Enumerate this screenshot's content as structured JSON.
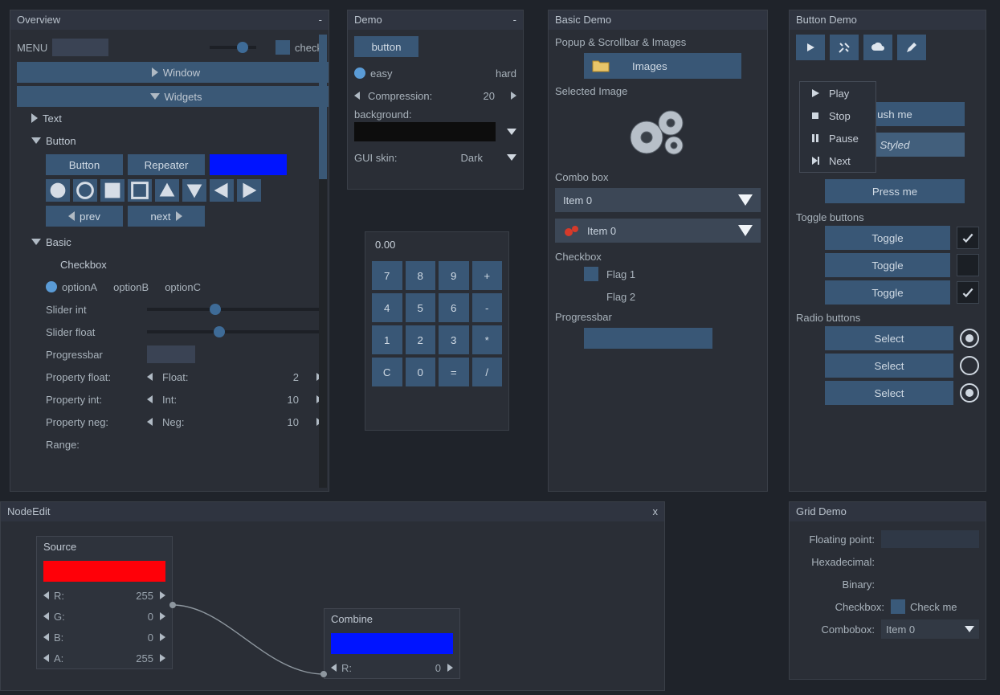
{
  "overview": {
    "title": "Overview",
    "menu_label": "MENU",
    "check_label": "check",
    "tree": {
      "window": "Window",
      "widgets": "Widgets",
      "text": "Text",
      "button": "Button",
      "basic": "Basic",
      "checkbox_label": "Checkbox"
    },
    "buttons": {
      "button": "Button",
      "repeater": "Repeater",
      "prev": "prev",
      "next": "next"
    },
    "options": {
      "a": "optionA",
      "b": "optionB",
      "c": "optionC"
    },
    "sliders": {
      "int_label": "Slider int",
      "float_label": "Slider float"
    },
    "progress_label": "Progressbar",
    "props": {
      "float": {
        "label": "Property float:",
        "name": "Float:",
        "value": "2"
      },
      "int": {
        "label": "Property int:",
        "name": "Int:",
        "value": "10"
      },
      "neg": {
        "label": "Property neg:",
        "name": "Neg:",
        "value": "10"
      },
      "range": "Range:"
    },
    "colors": {
      "swatch": "#0014ff"
    }
  },
  "demo": {
    "title": "Demo",
    "button": "button",
    "easy": "easy",
    "hard": "hard",
    "compression": {
      "label": "Compression:",
      "value": "20"
    },
    "background_label": "background:",
    "gui_skin": {
      "label": "GUI skin:",
      "value": "Dark"
    }
  },
  "calc": {
    "display": "0.00",
    "keys": [
      [
        "7",
        "8",
        "9",
        "+"
      ],
      [
        "4",
        "5",
        "6",
        "-"
      ],
      [
        "1",
        "2",
        "3",
        "*"
      ],
      [
        "C",
        "0",
        "=",
        "/"
      ]
    ]
  },
  "basic_demo": {
    "title": "Basic Demo",
    "popup_label": "Popup & Scrollbar & Images",
    "images_button": "Images",
    "selected_label": "Selected Image",
    "combo_label": "Combo box",
    "combo1": "Item 0",
    "combo2": "Item 0",
    "checkbox_label": "Checkbox",
    "flag1": "Flag 1",
    "flag2": "Flag 2",
    "progress_label": "Progressbar"
  },
  "button_demo": {
    "title": "Button Demo",
    "push_me": "ush me",
    "styled": "Styled",
    "press_me": "Press me",
    "toggle_label": "Toggle buttons",
    "toggle": "Toggle",
    "radio_label": "Radio buttons",
    "select": "Select",
    "menu": {
      "play": "Play",
      "stop": "Stop",
      "pause": "Pause",
      "next": "Next"
    }
  },
  "node_edit": {
    "title": "NodeEdit",
    "close": "x",
    "source": {
      "title": "Source",
      "color": "#ff0008",
      "r": {
        "label": "R:",
        "value": "255"
      },
      "g": {
        "label": "G:",
        "value": "0"
      },
      "b": {
        "label": "B:",
        "value": "0"
      },
      "a": {
        "label": "A:",
        "value": "255"
      }
    },
    "combine": {
      "title": "Combine",
      "color": "#0014ff",
      "r": {
        "label": "R:",
        "value": "0"
      }
    }
  },
  "grid_demo": {
    "title": "Grid Demo",
    "rows": {
      "floating": "Floating point:",
      "hex": "Hexadecimal:",
      "binary": "Binary:",
      "checkbox": "Checkbox:",
      "check_me": "Check me",
      "combobox": "Combobox:",
      "combo_value": "Item 0"
    }
  }
}
